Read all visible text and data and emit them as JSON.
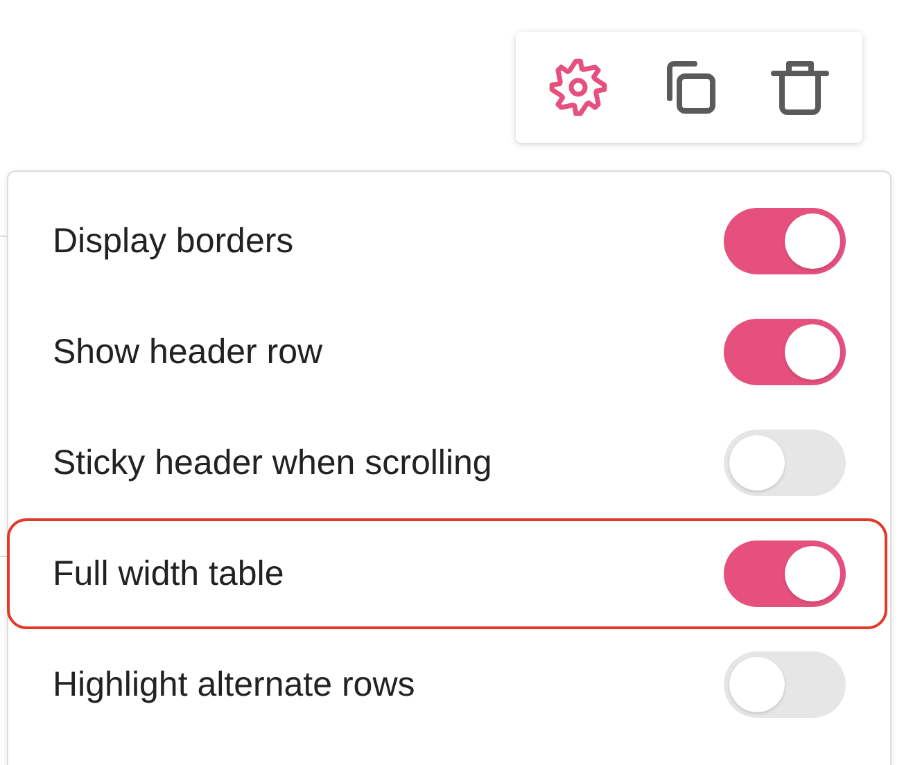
{
  "toolbar": [
    {
      "kind": "settings",
      "selected": true
    },
    {
      "kind": "duplicate",
      "selected": false
    },
    {
      "kind": "delete",
      "selected": false
    }
  ],
  "settings": [
    {
      "label": "Display borders",
      "on": true,
      "highlighted": false
    },
    {
      "label": "Show header row",
      "on": true,
      "highlighted": false
    },
    {
      "label": "Sticky header when scrolling",
      "on": false,
      "highlighted": false
    },
    {
      "label": "Full width table",
      "on": true,
      "highlighted": true
    },
    {
      "label": "Highlight alternate rows",
      "on": false,
      "highlighted": false
    }
  ]
}
